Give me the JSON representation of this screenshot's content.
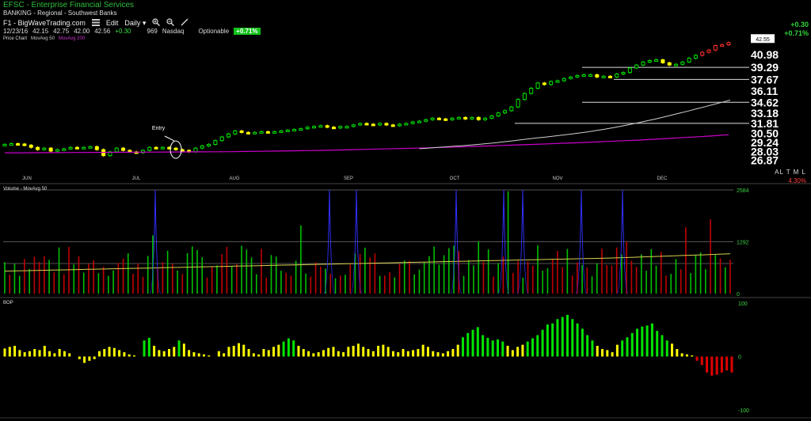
{
  "header": {
    "title": "EFSC - Enterprise Financial Services",
    "sector": "BANKING - Regional - Southwest Banks",
    "toolbar": {
      "source": "F1 - BigWaveTrading.com",
      "edit": "Edit",
      "period": "Daily"
    },
    "quote": {
      "date": "12/23/16",
      "open": "42.15",
      "high": "42.75",
      "low": "42.00",
      "close": "42.56",
      "change": "+0.30",
      "volume": "969",
      "exchange": "Nasdaq",
      "optionable": "Optionable",
      "percent": "+0.71%"
    },
    "legend": {
      "price": "Price Chart",
      "ma50": "MovAvg 50",
      "ma200": "MovAvg 200"
    },
    "right_change": "+0.30",
    "right_percent": "+0.71%",
    "alt_ml": "AL T M L",
    "right_pct": "4.30%"
  },
  "colors": {
    "up": "#00e600",
    "down": "#ffff00",
    "ma50": "#cfcfcf",
    "ma200": "#cc00cc",
    "vol_up": "#00c000",
    "vol_down": "#c00000",
    "vol_ma": "#d8d050",
    "spike": "#3030ff",
    "bop_up": "#00e600",
    "bop_mid": "#ffff00",
    "bop_down": "#e00000"
  },
  "chart_data": [
    {
      "type": "candlestick",
      "panel": "price",
      "annotation": "Entry",
      "months": [
        "JUN",
        "JUL",
        "AUG",
        "SEP",
        "OCT",
        "NOV",
        "DEC"
      ],
      "y_ticks": [
        "40.98",
        "39.29",
        "37.67",
        "36.11",
        "34.62",
        "33.18",
        "31.81",
        "30.50",
        "29.24",
        "28.03",
        "26.87"
      ],
      "last_price": "42.55",
      "ylim": [
        26.3,
        43.0
      ],
      "close": [
        29.0,
        29.1,
        29.05,
        28.9,
        28.6,
        28.3,
        28.5,
        28.1,
        28.3,
        28.4,
        28.6,
        28.5,
        28.6,
        28.7,
        28.3,
        27.5,
        28.0,
        28.5,
        28.2,
        28.0,
        27.9,
        28.2,
        28.6,
        28.5,
        28.6,
        28.5,
        28.3,
        28.2,
        28.0,
        28.5,
        28.8,
        29.0,
        29.5,
        30.0,
        30.4,
        30.8,
        30.6,
        30.5,
        30.6,
        30.7,
        30.6,
        30.7,
        30.8,
        30.9,
        31.0,
        31.1,
        31.3,
        31.4,
        31.5,
        31.3,
        31.2,
        31.4,
        31.4,
        31.6,
        31.8,
        31.7,
        31.6,
        31.8,
        31.6,
        31.5,
        31.7,
        31.8,
        32.0,
        32.1,
        32.3,
        32.5,
        32.4,
        32.3,
        32.5,
        32.6,
        32.4,
        32.6,
        32.3,
        32.5,
        32.8,
        33.2,
        33.5,
        34.0,
        35.0,
        35.8,
        36.5,
        37.2,
        37.0,
        37.4,
        37.5,
        37.8,
        38.0,
        38.2,
        38.3,
        38.3,
        38.0,
        38.1,
        38.0,
        38.4,
        38.6,
        39.2,
        39.6,
        40.0,
        40.2,
        40.3,
        39.9,
        39.6,
        39.7,
        40.0,
        40.5,
        40.9,
        41.3,
        41.6,
        42.2,
        42.3,
        42.6
      ],
      "ma50": [
        28.42,
        28.5,
        28.58,
        28.66,
        28.74,
        28.82,
        28.9,
        29.0,
        29.1,
        29.21,
        29.33,
        29.46,
        29.6,
        29.74,
        29.86,
        29.98,
        30.1,
        30.23,
        30.37,
        30.52,
        30.67,
        30.84,
        31.01,
        31.22,
        31.43,
        31.65,
        31.87,
        32.12,
        32.37,
        32.63,
        32.91,
        33.18,
        33.46,
        33.75,
        34.04,
        34.33,
        34.62,
        34.91
      ],
      "ma200": [
        27.87,
        27.88,
        27.89,
        27.9,
        27.91,
        27.92,
        27.93,
        27.94,
        27.95,
        27.96,
        27.97,
        27.98,
        27.99,
        28.0,
        28.01,
        28.02,
        28.05,
        28.08,
        28.11,
        28.14,
        28.17,
        28.2,
        28.25,
        28.3,
        28.34,
        28.39,
        28.44,
        28.49,
        28.54,
        28.59,
        28.66,
        28.72,
        28.78,
        28.86,
        28.93,
        29.0,
        29.07,
        29.15,
        29.22,
        29.31,
        29.4,
        29.49,
        29.57,
        29.68,
        29.79,
        29.91,
        30.02,
        30.15,
        30.3
      ],
      "ma50_start_index": 63
    },
    {
      "type": "bar",
      "panel": "volume",
      "legend": "Volume - MovAvg 50",
      "y_ticks": [
        "2584",
        "1292",
        "0"
      ],
      "ylim": [
        0,
        2584
      ]
    },
    {
      "type": "bar",
      "panel": "bop",
      "legend": "BOP",
      "y_ticks": [
        "100",
        "0",
        "-100"
      ],
      "ylim": [
        -100,
        100
      ],
      "values": [
        15,
        18,
        20,
        12,
        8,
        10,
        14,
        12,
        20,
        10,
        6,
        14,
        10,
        6,
        0,
        -5,
        -12,
        -8,
        -5,
        10,
        14,
        18,
        16,
        12,
        8,
        4,
        2,
        0,
        30,
        35,
        20,
        12,
        10,
        14,
        18,
        30,
        24,
        12,
        8,
        6,
        4,
        2,
        0,
        10,
        6,
        18,
        20,
        25,
        22,
        14,
        6,
        4,
        14,
        12,
        18,
        22,
        28,
        34,
        30,
        20,
        14,
        10,
        6,
        8,
        12,
        16,
        18,
        10,
        8,
        18,
        20,
        24,
        18,
        14,
        10,
        20,
        22,
        18,
        10,
        8,
        14,
        10,
        12,
        14,
        22,
        18,
        10,
        8,
        6,
        10,
        14,
        22,
        36,
        44,
        50,
        55,
        40,
        35,
        30,
        32,
        28,
        20,
        12,
        18,
        22,
        28,
        34,
        40,
        50,
        60,
        62,
        70,
        74,
        78,
        70,
        62,
        52,
        40,
        30,
        20,
        14,
        12,
        8,
        22,
        30,
        36,
        44,
        52,
        56,
        58,
        62,
        48,
        40,
        30,
        24,
        14,
        6,
        4,
        2,
        -8,
        -16,
        -30,
        -36,
        -34,
        -30,
        -26,
        -30
      ]
    }
  ]
}
